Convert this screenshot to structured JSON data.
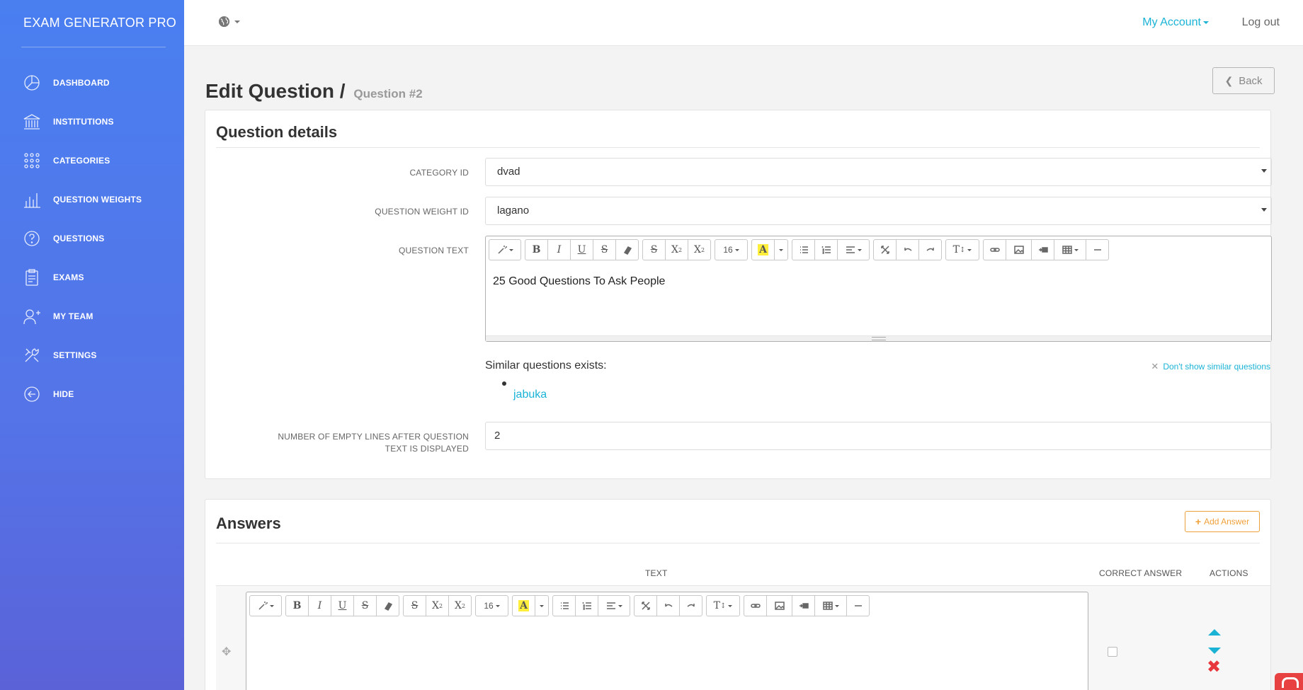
{
  "app": {
    "brand": "EXAM GENERATOR PRO"
  },
  "sidebar": {
    "items": [
      {
        "label": "DASHBOARD",
        "icon": "dashboard-icon"
      },
      {
        "label": "INSTITUTIONS",
        "icon": "institution-icon"
      },
      {
        "label": "CATEGORIES",
        "icon": "categories-icon"
      },
      {
        "label": "QUESTION WEIGHTS",
        "icon": "bar-chart-icon"
      },
      {
        "label": "QUESTIONS",
        "icon": "question-icon"
      },
      {
        "label": "EXAMS",
        "icon": "clipboard-icon"
      },
      {
        "label": "MY TEAM",
        "icon": "add-user-icon"
      },
      {
        "label": "SETTINGS",
        "icon": "tools-icon"
      },
      {
        "label": "HIDE",
        "icon": "arrow-left-circle-icon"
      }
    ]
  },
  "topbar": {
    "my_account": "My Account",
    "logout": "Log out"
  },
  "page": {
    "title": "Edit Question",
    "separator": "/",
    "subtitle": "Question #2",
    "back": "Back"
  },
  "question_details": {
    "title": "Question details",
    "category_label": "CATEGORY ID",
    "category_value": "dvad",
    "weight_label": "QUESTION WEIGHT ID",
    "weight_value": "lagano",
    "text_label": "QUESTION TEXT",
    "text_value": "25 Good Questions To Ask People",
    "font_size": "16",
    "similar_title": "Similar questions exists:",
    "dont_show": "Don't show similar questions",
    "similar_items": [
      "jabuka"
    ],
    "empty_lines_label": "NUMBER OF EMPTY LINES AFTER QUESTION TEXT IS DISPLAYED",
    "empty_lines_value": "2"
  },
  "answers": {
    "title": "Answers",
    "add": "Add Answer",
    "col_text": "TEXT",
    "col_correct": "CORRECT ANSWER",
    "col_actions": "ACTIONS",
    "font_size": "16"
  },
  "colors": {
    "accent": "#1ab3d6",
    "sidebar_top": "#4a7ff0",
    "sidebar_bottom": "#5b62d8",
    "add": "#f0a03a",
    "delete": "#e8373c",
    "highlight": "#ffef3c"
  }
}
